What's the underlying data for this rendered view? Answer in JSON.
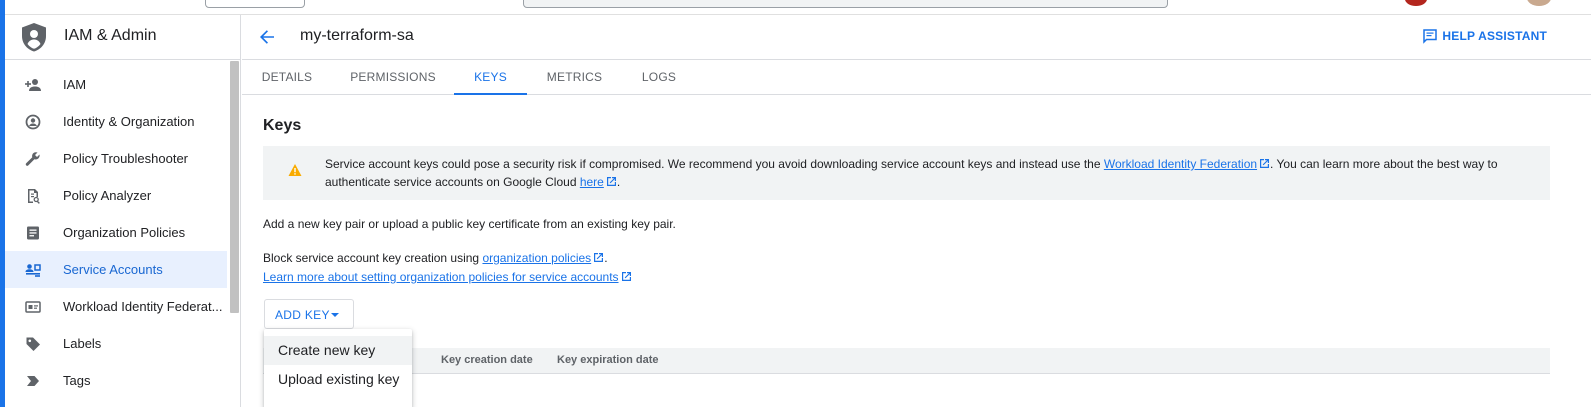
{
  "app": {
    "title": "IAM & Admin"
  },
  "sidebar": {
    "items": [
      {
        "label": "IAM",
        "icon": "add-person-icon"
      },
      {
        "label": "Identity & Organization",
        "icon": "account-circle-icon"
      },
      {
        "label": "Policy Troubleshooter",
        "icon": "wrench-icon"
      },
      {
        "label": "Policy Analyzer",
        "icon": "document-search-icon"
      },
      {
        "label": "Organization Policies",
        "icon": "list-document-icon"
      },
      {
        "label": "Service Accounts",
        "icon": "service-account-icon",
        "active": true
      },
      {
        "label": "Workload Identity Federat...",
        "icon": "id-card-icon"
      },
      {
        "label": "Labels",
        "icon": "tag-icon"
      },
      {
        "label": "Tags",
        "icon": "chevron-tag-icon"
      }
    ]
  },
  "header": {
    "title": "my-terraform-sa",
    "help_label": "HELP ASSISTANT"
  },
  "tabs": [
    {
      "label": "DETAILS"
    },
    {
      "label": "PERMISSIONS"
    },
    {
      "label": "KEYS",
      "active": true
    },
    {
      "label": "METRICS"
    },
    {
      "label": "LOGS"
    }
  ],
  "keys": {
    "title": "Keys",
    "warning": {
      "text_1": "Service account keys could pose a security risk if compromised. We recommend you avoid downloading service account keys and instead use the ",
      "link_1": "Workload Identity Federation",
      "text_2": ". You can learn more about the best way to authenticate service accounts on Google Cloud ",
      "link_2": "here",
      "text_3": "."
    },
    "intro": "Add a new key pair or upload a public key certificate from an existing key pair.",
    "block_text": "Block service account key creation using ",
    "block_link": "organization policies",
    "block_end": ".",
    "learn_more_link": "Learn more about setting organization policies for service accounts",
    "add_key_label": "ADD KEY",
    "table_headers": [
      "Key creation date",
      "Key expiration date"
    ],
    "menu": [
      "Create new key",
      "Upload existing key"
    ]
  },
  "colors": {
    "accent": "#1a73e8",
    "active_bg": "#e8f0fe",
    "warning": "#f9ab00"
  }
}
